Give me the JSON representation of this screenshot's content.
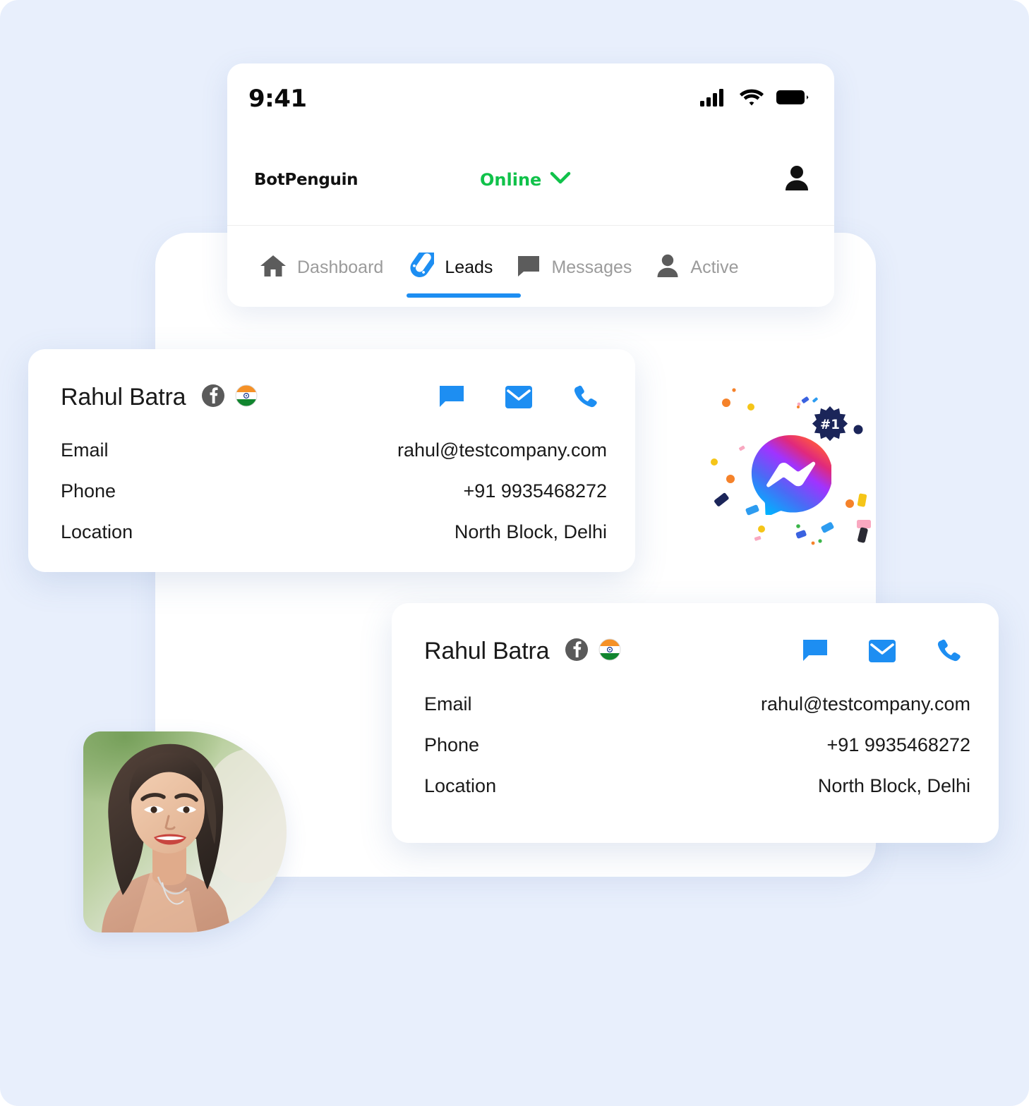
{
  "theme": {
    "page_background": "#e8effc",
    "accent_blue": "#1d8ef2",
    "online_green": "#10c24a",
    "text_dark": "#1a1a1a",
    "text_muted": "#9b9b9b"
  },
  "phone": {
    "status_bar": {
      "time": "9:41",
      "signal_icon": "signal-bars-icon",
      "wifi_icon": "wifi-icon",
      "battery_icon": "battery-icon"
    },
    "header": {
      "brand": "BotPenguin",
      "status_label": "Online",
      "status_chevron_icon": "chevron-down-icon",
      "profile_icon": "person-icon"
    },
    "tabs": [
      {
        "label": "Dashboard",
        "icon": "home-icon",
        "active": false
      },
      {
        "label": "Leads",
        "icon": "magnet-icon",
        "active": true
      },
      {
        "label": "Messages",
        "icon": "chat-bubble-icon",
        "active": false
      },
      {
        "label": "Active",
        "icon": "person-icon",
        "active": false
      }
    ]
  },
  "lead_cards": [
    {
      "name": "Rahul Batra",
      "source_icon": "facebook-icon",
      "country_icon": "india-flag-icon",
      "actions": [
        "chat-icon",
        "email-icon",
        "phone-icon"
      ],
      "fields": [
        {
          "label": "Email",
          "value": "rahul@testcompany.com"
        },
        {
          "label": "Phone",
          "value": "+91 9935468272"
        },
        {
          "label": "Location",
          "value": "North Block, Delhi"
        }
      ]
    },
    {
      "name": "Rahul Batra",
      "source_icon": "facebook-icon",
      "country_icon": "india-flag-icon",
      "actions": [
        "chat-icon",
        "email-icon",
        "phone-icon"
      ],
      "fields": [
        {
          "label": "Email",
          "value": "rahul@testcompany.com"
        },
        {
          "label": "Phone",
          "value": "+91 9935468272"
        },
        {
          "label": "Location",
          "value": "North Block, Delhi"
        }
      ]
    }
  ],
  "illustration": {
    "logo_icon": "messenger-logo-icon",
    "badge_label": "#1",
    "badge_shape": "starburst",
    "confetti_colors": [
      "#f5822a",
      "#f5c518",
      "#1d8ef2",
      "#1b2559",
      "#f9a8c0",
      "#3bb54a"
    ]
  },
  "portrait": {
    "icon": "portrait-photo",
    "alt": "smiling woman portrait"
  }
}
